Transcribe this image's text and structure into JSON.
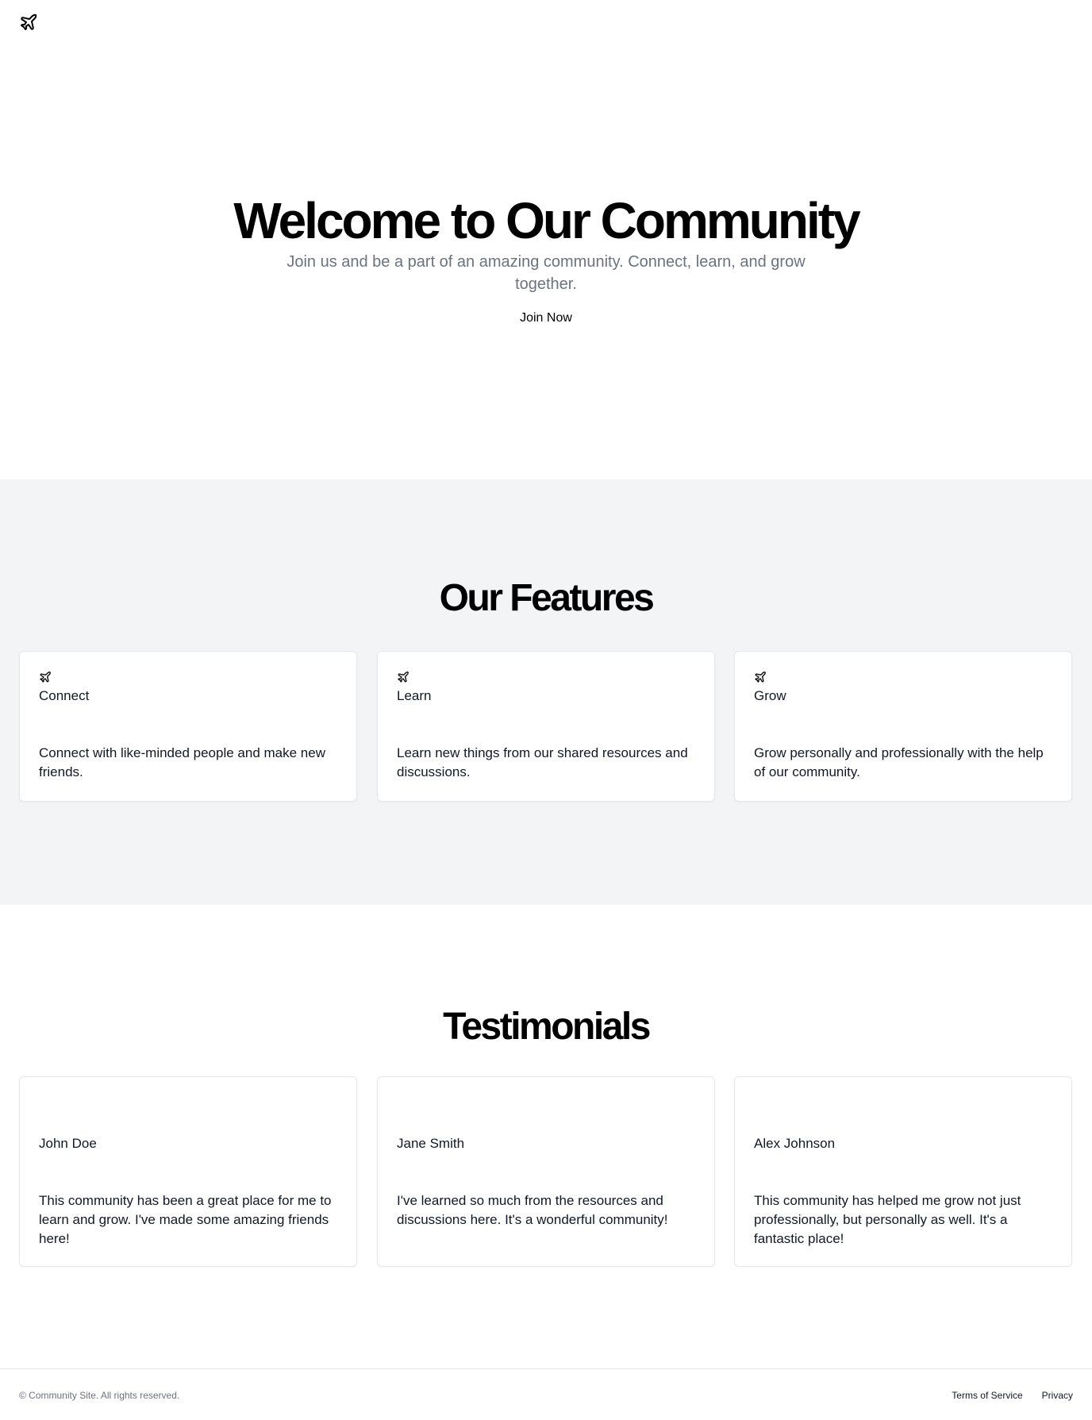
{
  "header": {
    "logo_icon": "rocket-icon"
  },
  "hero": {
    "title": "Welcome to Our Community",
    "subtitle": "Join us and be a part of an amazing community. Connect, learn, and grow together.",
    "cta_label": "Join Now"
  },
  "features": {
    "title": "Our Features",
    "items": [
      {
        "icon": "rocket-icon",
        "title": "Connect",
        "text": "Connect with like-minded people and make new friends."
      },
      {
        "icon": "rocket-icon",
        "title": "Learn",
        "text": "Learn new things from our shared resources and discussions."
      },
      {
        "icon": "rocket-icon",
        "title": "Grow",
        "text": "Grow personally and professionally with the help of our community."
      }
    ]
  },
  "testimonials": {
    "title": "Testimonials",
    "items": [
      {
        "name": "John Doe",
        "text": "This community has been a great place for me to learn and grow. I've made some amazing friends here!"
      },
      {
        "name": "Jane Smith",
        "text": "I've learned so much from the resources and discussions here. It's a wonderful community!"
      },
      {
        "name": "Alex Johnson",
        "text": "This community has helped me grow not just professionally, but personally as well. It's a fantastic place!"
      }
    ]
  },
  "footer": {
    "copyright": "© Community Site. All rights reserved.",
    "links": [
      "Terms of Service",
      "Privacy"
    ]
  },
  "colors": {
    "section_bg": "#f3f4f6",
    "muted_text": "#6b7280",
    "border": "#e5e7eb"
  }
}
